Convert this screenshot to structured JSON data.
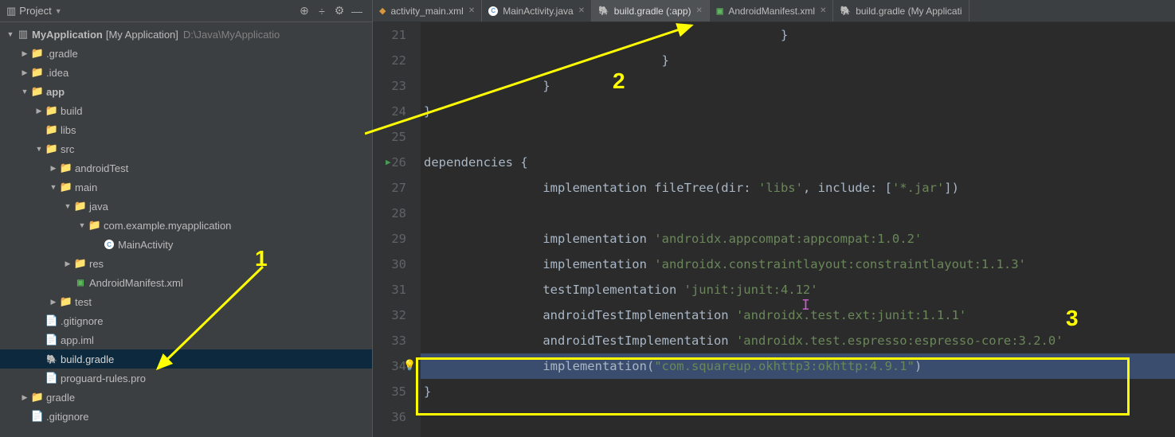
{
  "sidebar": {
    "title": "Project",
    "root": {
      "name": "MyApplication",
      "bracket": "[My Application]",
      "path": "D:\\Java\\MyApplicatio"
    },
    "items": [
      {
        "label": ".gradle",
        "indent": 1,
        "arrow": "▶",
        "iconType": "folder-orange"
      },
      {
        "label": ".idea",
        "indent": 1,
        "arrow": "▶",
        "iconType": "folder"
      },
      {
        "label": "app",
        "indent": 1,
        "arrow": "▼",
        "iconType": "folder",
        "bold": true
      },
      {
        "label": "build",
        "indent": 2,
        "arrow": "▶",
        "iconType": "folder-orange"
      },
      {
        "label": "libs",
        "indent": 2,
        "arrow": "",
        "iconType": "folder"
      },
      {
        "label": "src",
        "indent": 2,
        "arrow": "▼",
        "iconType": "folder"
      },
      {
        "label": "androidTest",
        "indent": 3,
        "arrow": "▶",
        "iconType": "folder"
      },
      {
        "label": "main",
        "indent": 3,
        "arrow": "▼",
        "iconType": "folder"
      },
      {
        "label": "java",
        "indent": 4,
        "arrow": "▼",
        "iconType": "folder-blue"
      },
      {
        "label": "com.example.myapplication",
        "indent": 5,
        "arrow": "▼",
        "iconType": "folder"
      },
      {
        "label": "MainActivity",
        "indent": 6,
        "arrow": "",
        "iconType": "java"
      },
      {
        "label": "res",
        "indent": 4,
        "arrow": "▶",
        "iconType": "folder"
      },
      {
        "label": "AndroidManifest.xml",
        "indent": 4,
        "arrow": "",
        "iconType": "mf"
      },
      {
        "label": "test",
        "indent": 3,
        "arrow": "▶",
        "iconType": "folder"
      },
      {
        "label": ".gitignore",
        "indent": 2,
        "arrow": "",
        "iconType": "file"
      },
      {
        "label": "app.iml",
        "indent": 2,
        "arrow": "",
        "iconType": "file"
      },
      {
        "label": "build.gradle",
        "indent": 2,
        "arrow": "",
        "iconType": "gradle",
        "selected": true
      },
      {
        "label": "proguard-rules.pro",
        "indent": 2,
        "arrow": "",
        "iconType": "file"
      },
      {
        "label": "gradle",
        "indent": 1,
        "arrow": "▶",
        "iconType": "folder"
      },
      {
        "label": ".gitignore",
        "indent": 1,
        "arrow": "",
        "iconType": "file"
      }
    ]
  },
  "tabs": [
    {
      "label": "activity_main.xml",
      "icon": "xml",
      "active": false
    },
    {
      "label": "MainActivity.java",
      "icon": "java",
      "active": false
    },
    {
      "label": "build.gradle (:app)",
      "icon": "gradle",
      "active": true
    },
    {
      "label": "AndroidManifest.xml",
      "icon": "mf",
      "active": false
    },
    {
      "label": "build.gradle (My Applicati",
      "icon": "gradle",
      "active": false,
      "noClose": true
    }
  ],
  "editor": {
    "startLine": 21,
    "lines": [
      {
        "indent": 12,
        "content": [
          {
            "t": "punct",
            "v": "}"
          }
        ]
      },
      {
        "indent": 8,
        "content": [
          {
            "t": "punct",
            "v": "}"
          }
        ]
      },
      {
        "indent": 4,
        "content": [
          {
            "t": "punct",
            "v": "}"
          }
        ]
      },
      {
        "indent": 0,
        "content": [
          {
            "t": "punct",
            "v": "}"
          }
        ]
      },
      {
        "indent": 0,
        "content": []
      },
      {
        "indent": 0,
        "content": [
          {
            "t": "kw",
            "v": "dependencies"
          },
          {
            "t": "punct",
            "v": " {"
          }
        ],
        "runMark": true
      },
      {
        "indent": 4,
        "content": [
          {
            "t": "method",
            "v": "implementation "
          },
          {
            "t": "method",
            "v": "fileTree"
          },
          {
            "t": "paren",
            "v": "("
          },
          {
            "t": "param",
            "v": "dir"
          },
          {
            "t": "punct",
            "v": ": "
          },
          {
            "t": "str",
            "v": "'libs'"
          },
          {
            "t": "punct",
            "v": ", "
          },
          {
            "t": "param",
            "v": "include"
          },
          {
            "t": "punct",
            "v": ": ["
          },
          {
            "t": "str",
            "v": "'*.jar'"
          },
          {
            "t": "punct",
            "v": "])"
          }
        ]
      },
      {
        "indent": 0,
        "content": []
      },
      {
        "indent": 4,
        "content": [
          {
            "t": "method",
            "v": "implementation "
          },
          {
            "t": "str",
            "v": "'androidx.appcompat:appcompat:1.0.2'"
          }
        ]
      },
      {
        "indent": 4,
        "content": [
          {
            "t": "method",
            "v": "implementation "
          },
          {
            "t": "str",
            "v": "'androidx.constraintlayout:constraintlayout:1.1.3'"
          }
        ]
      },
      {
        "indent": 4,
        "content": [
          {
            "t": "method",
            "v": "testImplementation "
          },
          {
            "t": "str",
            "v": "'junit:junit:4.12'"
          }
        ]
      },
      {
        "indent": 4,
        "content": [
          {
            "t": "method",
            "v": "androidTestImplementation "
          },
          {
            "t": "str",
            "v": "'androidx.test.ext:junit:1.1.1'"
          }
        ]
      },
      {
        "indent": 4,
        "content": [
          {
            "t": "method",
            "v": "androidTestImplementation "
          },
          {
            "t": "str",
            "v": "'androidx.test.espresso:espresso-core:3.2.0'"
          }
        ]
      },
      {
        "indent": 4,
        "content": [
          {
            "t": "method",
            "v": "implementation"
          },
          {
            "t": "paren",
            "v": "("
          },
          {
            "t": "str",
            "v": "\"com.squareup.okhttp3:okhttp:4.9.1\""
          },
          {
            "t": "paren",
            "v": ")"
          }
        ],
        "highlighted": true,
        "bulb": true
      },
      {
        "indent": 0,
        "content": [
          {
            "t": "punct",
            "v": "}"
          }
        ]
      },
      {
        "indent": 0,
        "content": []
      }
    ]
  },
  "annotations": {
    "a1": "1",
    "a2": "2",
    "a3": "3"
  }
}
